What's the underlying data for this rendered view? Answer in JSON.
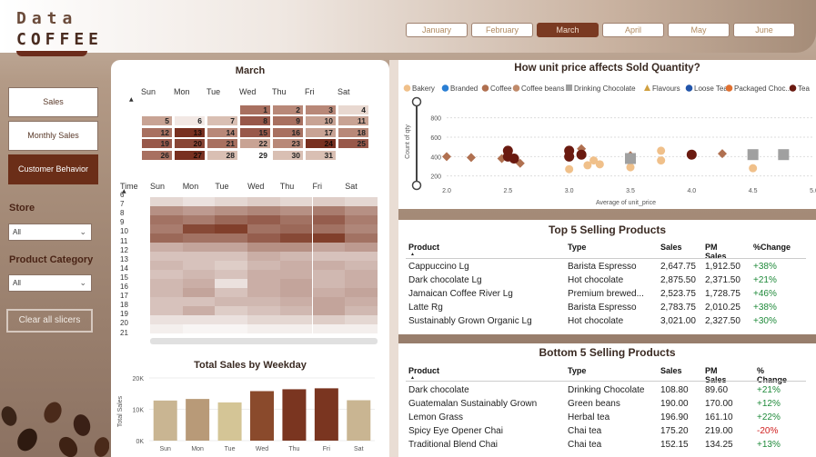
{
  "logo": {
    "line1": "Data",
    "line2": "COFFEE"
  },
  "months": [
    {
      "label": "January",
      "active": false
    },
    {
      "label": "February",
      "active": false
    },
    {
      "label": "March",
      "active": true
    },
    {
      "label": "April",
      "active": false
    },
    {
      "label": "May",
      "active": false
    },
    {
      "label": "June",
      "active": false
    }
  ],
  "nav": {
    "sales": "Sales",
    "monthly_sales": "Monthly Sales",
    "customer_behavior": "Customer Behavior"
  },
  "filters": {
    "store_label": "Store",
    "store_value": "All",
    "category_label": "Product Category",
    "category_value": "All",
    "clear_label": "Clear all slicers"
  },
  "calendar": {
    "title": "March",
    "days": [
      "Sun",
      "Mon",
      "Tue",
      "Wed",
      "Thu",
      "Fri",
      "Sat"
    ],
    "weeks": [
      [
        "",
        "",
        "",
        "",
        "1",
        "2",
        "3",
        "4"
      ],
      [
        "",
        "5",
        "6",
        "7",
        "8",
        "9",
        "10",
        "11"
      ],
      [
        "",
        "12",
        "13",
        "14",
        "15",
        "16",
        "17",
        "18"
      ],
      [
        "",
        "19",
        "20",
        "21",
        "22",
        "23",
        "24",
        "25"
      ],
      [
        "",
        "26",
        "27",
        "28",
        "29",
        "30",
        "31",
        ""
      ]
    ],
    "cells": [
      [
        null,
        null,
        null,
        5,
        4,
        4,
        1
      ],
      [
        3,
        0,
        2,
        6,
        5,
        3,
        3
      ],
      [
        5,
        8,
        4,
        6,
        5,
        3,
        4
      ],
      [
        6,
        7,
        5,
        3,
        4,
        8,
        6
      ],
      [
        5,
        8,
        2,
        null,
        2,
        2,
        null
      ]
    ]
  },
  "heatmap": {
    "time_label": "Time",
    "days": [
      "Sun",
      "Mon",
      "Tue",
      "Wed",
      "Thu",
      "Fri",
      "Sat"
    ],
    "hours": [
      "6",
      "7",
      "8",
      "9",
      "10",
      "11",
      "12",
      "13",
      "14",
      "15",
      "16",
      "17",
      "18",
      "19",
      "20",
      "21"
    ],
    "intensity": [
      [
        0.2,
        0.15,
        0.2,
        0.25,
        0.2,
        0.25,
        0.2
      ],
      [
        0.55,
        0.5,
        0.55,
        0.6,
        0.55,
        0.65,
        0.55
      ],
      [
        0.7,
        0.65,
        0.75,
        0.8,
        0.7,
        0.8,
        0.65
      ],
      [
        0.65,
        0.9,
        0.95,
        0.7,
        0.75,
        0.7,
        0.6
      ],
      [
        0.75,
        0.7,
        0.7,
        0.8,
        0.9,
        0.95,
        0.7
      ],
      [
        0.4,
        0.45,
        0.45,
        0.55,
        0.55,
        0.45,
        0.5
      ],
      [
        0.3,
        0.3,
        0.3,
        0.4,
        0.35,
        0.3,
        0.3
      ],
      [
        0.35,
        0.3,
        0.25,
        0.35,
        0.4,
        0.4,
        0.35
      ],
      [
        0.3,
        0.35,
        0.3,
        0.4,
        0.4,
        0.35,
        0.4
      ],
      [
        0.35,
        0.4,
        0.15,
        0.4,
        0.45,
        0.35,
        0.4
      ],
      [
        0.35,
        0.45,
        0.3,
        0.4,
        0.45,
        0.4,
        0.45
      ],
      [
        0.3,
        0.3,
        0.35,
        0.35,
        0.4,
        0.45,
        0.4
      ],
      [
        0.3,
        0.4,
        0.25,
        0.3,
        0.35,
        0.45,
        0.35
      ],
      [
        0.15,
        0.15,
        0.15,
        0.2,
        0.2,
        0.25,
        0.2
      ],
      [
        0.08,
        0.05,
        0.05,
        0.08,
        0.08,
        0.08,
        0.08
      ],
      [
        0.0,
        0.0,
        0.0,
        0.0,
        0.0,
        0.0,
        0.0
      ]
    ]
  },
  "colors": {
    "accent": "#6b2e18",
    "positive": "#1f8a3a",
    "negative": "#d02020",
    "heat": "#7a3520"
  },
  "chart_data": [
    {
      "type": "bar",
      "title": "Total Sales by Weekday",
      "xlabel": "",
      "ylabel": "Total Sales",
      "categories": [
        "Sun",
        "Mon",
        "Tue",
        "Wed",
        "Thu",
        "Fri",
        "Sat"
      ],
      "values": [
        12800,
        13300,
        12200,
        15800,
        16400,
        16700,
        12900
      ],
      "colors": [
        "#c9b592",
        "#b89a78",
        "#d4c596",
        "#8a4a2c",
        "#7a3520",
        "#7a3520",
        "#c9b592"
      ],
      "yticks": [
        "0K",
        "10K",
        "20K"
      ],
      "ylim": [
        0,
        20000
      ]
    },
    {
      "type": "scatter",
      "title": "How unit price affects Sold Quantity?",
      "xlabel": "Average of unit_price",
      "ylabel": "Count of qty",
      "xlim": [
        2.0,
        5.0
      ],
      "ylim": [
        150,
        900
      ],
      "xticks": [
        "2.0",
        "2.5",
        "3.0",
        "3.5",
        "4.0",
        "4.5",
        "5.0"
      ],
      "yticks": [
        "200",
        "400",
        "600",
        "800"
      ],
      "legend_position": "top",
      "series": [
        {
          "name": "Bakery",
          "color": "#f0c08a",
          "shape": "circle",
          "points": [
            [
              3.0,
              270
            ],
            [
              3.15,
              310
            ],
            [
              3.2,
              360
            ],
            [
              3.25,
              320
            ],
            [
              3.5,
              290
            ],
            [
              3.75,
              360
            ],
            [
              4.5,
              280
            ],
            [
              3.75,
              460
            ]
          ]
        },
        {
          "name": "Branded",
          "color": "#2a7fd4",
          "shape": "circle",
          "points": []
        },
        {
          "name": "Coffee",
          "color": "#b07050",
          "shape": "diamond",
          "points": [
            [
              2.0,
              400
            ],
            [
              2.2,
              390
            ],
            [
              2.45,
              380
            ],
            [
              2.6,
              330
            ],
            [
              3.1,
              440
            ],
            [
              3.1,
              480
            ],
            [
              3.5,
              410
            ],
            [
              4.25,
              430
            ]
          ]
        },
        {
          "name": "Coffee beans",
          "color": "#c08a6a",
          "shape": "circle",
          "points": []
        },
        {
          "name": "Drinking Chocolate",
          "color": "#a0a0a0",
          "shape": "square",
          "points": [
            [
              3.5,
              380
            ],
            [
              4.5,
              420
            ],
            [
              4.75,
              420
            ]
          ]
        },
        {
          "name": "Flavours",
          "color": "#d0a040",
          "shape": "triangle",
          "points": []
        },
        {
          "name": "Loose Tea",
          "color": "#2255aa",
          "shape": "circle",
          "points": []
        },
        {
          "name": "Packaged Choc...",
          "color": "#e07030",
          "shape": "circle",
          "points": []
        },
        {
          "name": "Tea",
          "color": "#6a1a10",
          "shape": "circle",
          "points": [
            [
              2.5,
              460
            ],
            [
              2.5,
              400
            ],
            [
              2.55,
              380
            ],
            [
              3.0,
              400
            ],
            [
              3.0,
              460
            ],
            [
              3.1,
              420
            ],
            [
              4.0,
              420
            ]
          ]
        }
      ]
    }
  ],
  "top5": {
    "title": "Top 5 Selling Products",
    "headers": [
      "Product",
      "Type",
      "Sales",
      "PM Sales",
      "%Change"
    ],
    "rows": [
      [
        "Cappuccino Lg",
        "Barista Espresso",
        "2,647.75",
        "1,912.50",
        "+38%"
      ],
      [
        "Dark chocolate Lg",
        "Hot chocolate",
        "2,875.50",
        "2,371.50",
        "+21%"
      ],
      [
        "Jamaican Coffee River Lg",
        "Premium brewed...",
        "2,523.75",
        "1,728.75",
        "+46%"
      ],
      [
        "Latte Rg",
        "Barista Espresso",
        "2,783.75",
        "2,010.25",
        "+38%"
      ],
      [
        "Sustainably Grown Organic Lg",
        "Hot chocolate",
        "3,021.00",
        "2,327.50",
        "+30%"
      ]
    ]
  },
  "bottom5": {
    "title": "Bottom 5 Selling Products",
    "headers": [
      "Product",
      "Type",
      "Sales",
      "PM Sales",
      "% Change"
    ],
    "rows": [
      [
        "Dark chocolate",
        "Drinking Chocolate",
        "108.80",
        "89.60",
        "+21%"
      ],
      [
        "Guatemalan Sustainably Grown",
        "Green beans",
        "190.00",
        "170.00",
        "+12%"
      ],
      [
        "Lemon Grass",
        "Herbal tea",
        "196.90",
        "161.10",
        "+22%"
      ],
      [
        "Spicy Eye Opener Chai",
        "Chai tea",
        "175.20",
        "219.00",
        "-20%"
      ],
      [
        "Traditional Blend Chai",
        "Chai tea",
        "152.15",
        "134.25",
        "+13%"
      ]
    ]
  }
}
